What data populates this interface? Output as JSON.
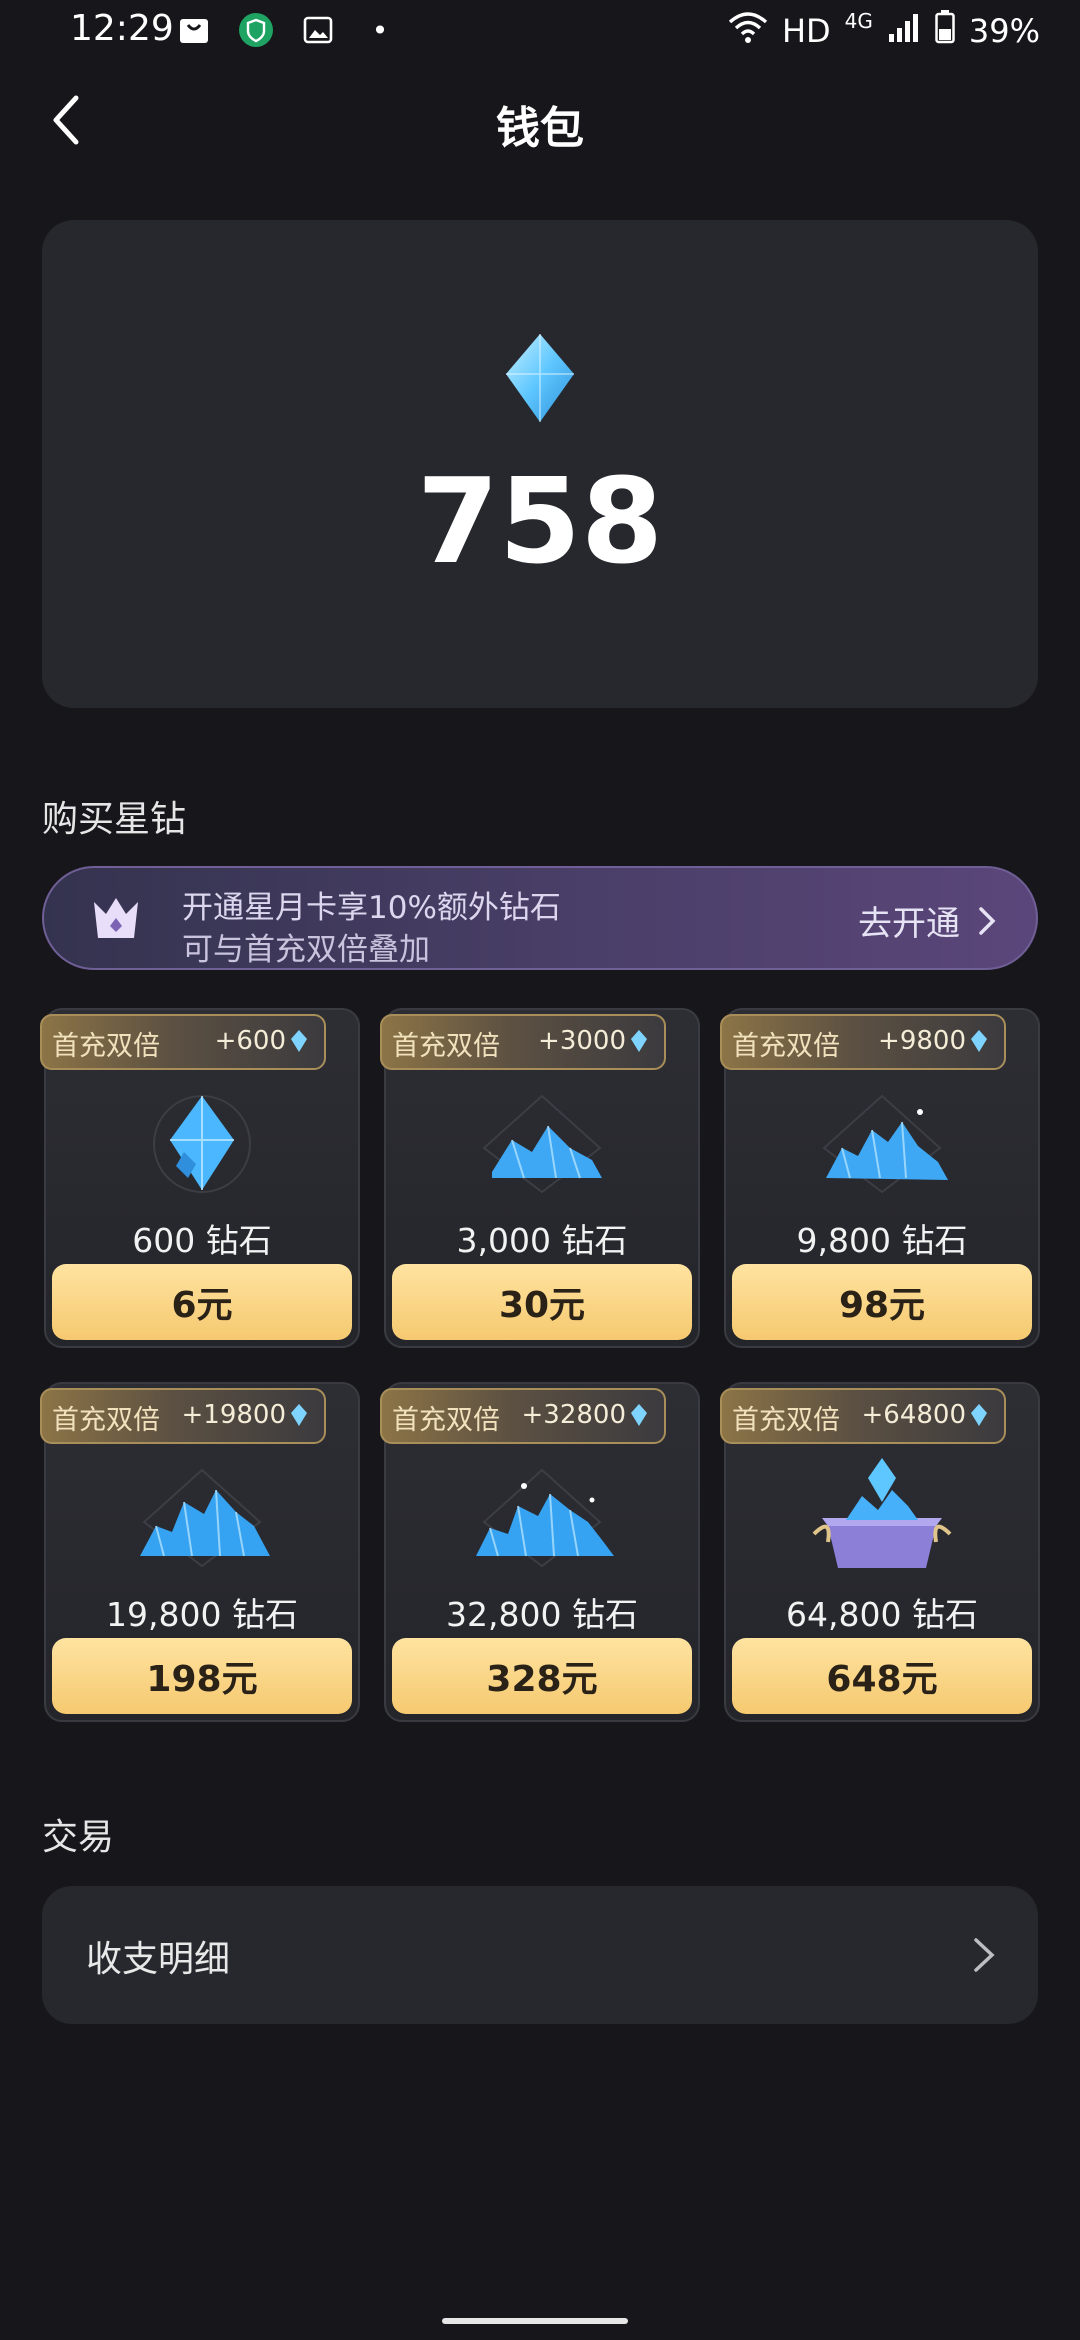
{
  "status_bar": {
    "time": "12:29",
    "network_hd": "HD",
    "network_4g": "4G",
    "battery": "39%",
    "dot": "•"
  },
  "header": {
    "title": "钱包"
  },
  "balance": {
    "value": "758"
  },
  "buy_section": {
    "title": "购买星钻"
  },
  "promo": {
    "line1": "开通星月卡享10%额外钻石",
    "line2": "可与首充双倍叠加",
    "action": "去开通"
  },
  "packages": [
    {
      "tag": "首充双倍",
      "bonus": "+600",
      "amount": "600 钻石",
      "price": "6元"
    },
    {
      "tag": "首充双倍",
      "bonus": "+3000",
      "amount": "3,000 钻石",
      "price": "30元"
    },
    {
      "tag": "首充双倍",
      "bonus": "+9800",
      "amount": "9,800 钻石",
      "price": "98元"
    },
    {
      "tag": "首充双倍",
      "bonus": "+19800",
      "amount": "19,800 钻石",
      "price": "198元"
    },
    {
      "tag": "首充双倍",
      "bonus": "+32800",
      "amount": "32,800 钻石",
      "price": "328元"
    },
    {
      "tag": "首充双倍",
      "bonus": "+64800",
      "amount": "64,800 钻石",
      "price": "648元"
    }
  ],
  "trade_section": {
    "title": "交易",
    "row_label": "收支明细"
  },
  "colors": {
    "background": "#17171b",
    "card": "#27282d",
    "price_gold": "#f5c970",
    "gem_blue": "#5fc7ff"
  }
}
